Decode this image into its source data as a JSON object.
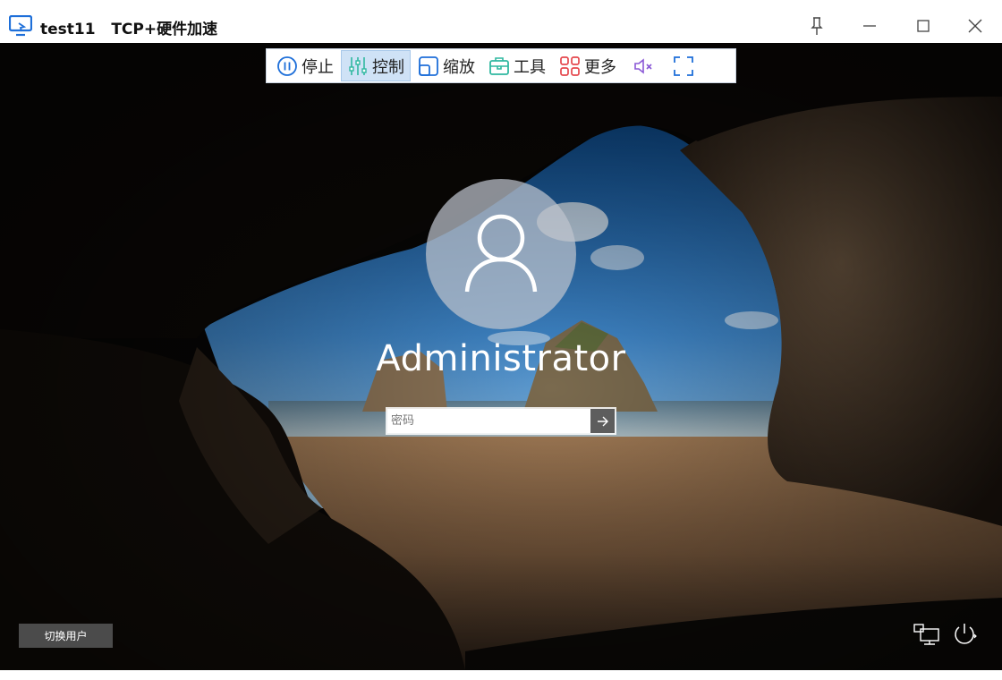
{
  "window": {
    "title": "test11   TCP+硬件加速",
    "icons": [
      "monitor-icon",
      "pin-icon",
      "minimize-icon",
      "maximize-icon",
      "close-icon"
    ]
  },
  "toolbar": {
    "items": [
      {
        "label": "停止",
        "icon": "pause-icon",
        "active": false
      },
      {
        "label": "控制",
        "icon": "sliders-icon",
        "active": true
      },
      {
        "label": "缩放",
        "icon": "scale-icon",
        "active": false
      },
      {
        "label": "工具",
        "icon": "toolbox-icon",
        "active": false
      },
      {
        "label": "更多",
        "icon": "grid-icon",
        "active": false
      }
    ],
    "extra_icons": [
      "mute-icon",
      "fullscreen-icon"
    ],
    "colors": {
      "pause": "#1e6fd9",
      "sliders": "#2fb8a0",
      "scale": "#1e6fd9",
      "toolbox": "#2fb8a0",
      "grid": "#e5484d",
      "mute": "#8a58d6",
      "fullscreen": "#1e6fd9"
    }
  },
  "login": {
    "avatar_icon": "user-icon",
    "username": "Administrator",
    "password_placeholder": "密码",
    "submit_icon": "arrow-right-icon"
  },
  "bottom": {
    "switch_user_label": "切换用户",
    "icons": [
      "network-icon",
      "power-icon"
    ]
  }
}
